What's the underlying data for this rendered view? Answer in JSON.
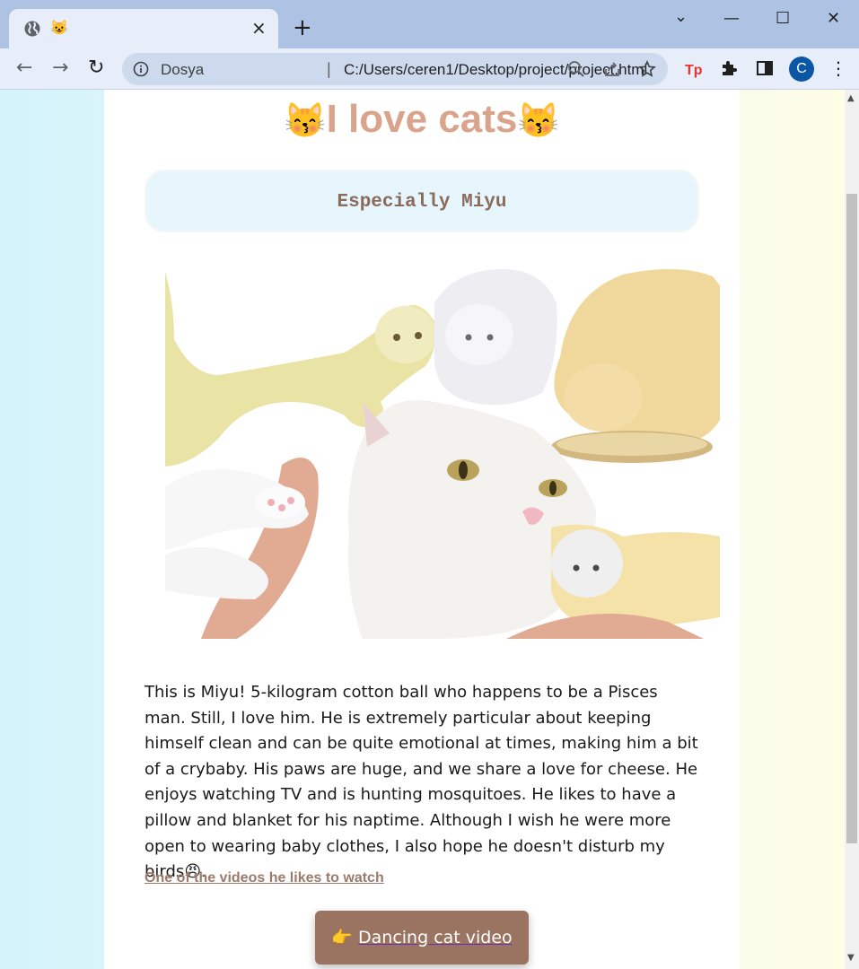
{
  "browser": {
    "tab": {
      "favicon": "😺",
      "close_glyph": "×"
    },
    "newtab_glyph": "+",
    "window": {
      "dropdown": "⌄",
      "minimize": "—",
      "maximize": "☐",
      "close": "✕"
    },
    "nav": {
      "back": "←",
      "forward": "→",
      "reload": "↻"
    },
    "address": {
      "site_name": "Dosya",
      "separator": "|",
      "url": "C:/Users/ceren1/Desktop/project/project.html"
    },
    "avatar_letter": "C",
    "menu_glyph": "⋮",
    "accent": "#0b57a4"
  },
  "page": {
    "title": {
      "emoji_left": "😽",
      "text": "I love cats",
      "emoji_right": "😽",
      "color": "#d9a48b"
    },
    "subtitle": "Especially Miyu",
    "description": "This is Miyu! 5-kilogram cotton ball who happens to be a Pisces man. Still, I love him. He is extremely particular about keeping himself clean and can be quite emotional at times, making him a bit of a crybaby. His paws are huge, and we share a love for cheese. He enjoys watching TV and is hunting mosquitoes. He likes to have a pillow and blanket for his naptime. Although I wish he were more open to wearing baby clothes, I also hope he doesn't disturb my birds😠.",
    "video_link": "One of the videos he likes to watch",
    "video_button": {
      "emoji": "👉",
      "label": "Dancing cat video",
      "color": "#9a7461"
    }
  }
}
